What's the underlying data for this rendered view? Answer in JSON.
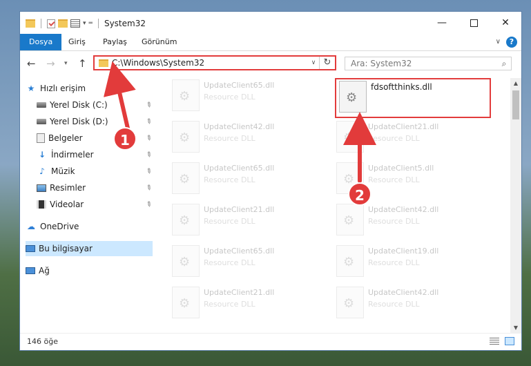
{
  "window": {
    "title": "System32"
  },
  "ribbon": {
    "tabs": [
      "Dosya",
      "Giriş",
      "Paylaş",
      "Görünüm"
    ],
    "help": "?"
  },
  "address": {
    "path": "C:\\Windows\\System32"
  },
  "search": {
    "placeholder": "Ara: System32"
  },
  "sidebar": {
    "quick_access": "Hızlı erişim",
    "items": [
      "Yerel Disk (C:)",
      "Yerel Disk (D:)",
      "Belgeler",
      "İndirmeler",
      "Müzik",
      "Resimler",
      "Videolar"
    ],
    "onedrive": "OneDrive",
    "this_pc": "Bu bilgisayar",
    "network": "Ağ"
  },
  "files": [
    {
      "name": "UpdateClient65.dll",
      "type": "Resource DLL"
    },
    {
      "name": "fdsoftthinks.dll",
      "type": ""
    },
    {
      "name": "UpdateClient42.dll",
      "type": "Resource DLL"
    },
    {
      "name": "UpdateClient21.dll",
      "type": "Resource DLL"
    },
    {
      "name": "UpdateClient65.dll",
      "type": "Resource DLL"
    },
    {
      "name": "UpdateClient5.dll",
      "type": "Resource DLL"
    },
    {
      "name": "UpdateClient21.dll",
      "type": "Resource DLL"
    },
    {
      "name": "UpdateClient42.dll",
      "type": "Resource DLL"
    },
    {
      "name": "UpdateClient65.dll",
      "type": "Resource DLL"
    },
    {
      "name": "UpdateClient19.dll",
      "type": "Resource DLL"
    },
    {
      "name": "UpdateClient21.dll",
      "type": "Resource DLL"
    },
    {
      "name": "UpdateClient42.dll",
      "type": "Resource DLL"
    }
  ],
  "status": {
    "count": "146 öğe"
  },
  "annotations": {
    "step1": "1",
    "step2": "2"
  },
  "colors": {
    "accent": "#1979ca",
    "highlight": "#e23b3b",
    "selected": "#cce8ff"
  }
}
